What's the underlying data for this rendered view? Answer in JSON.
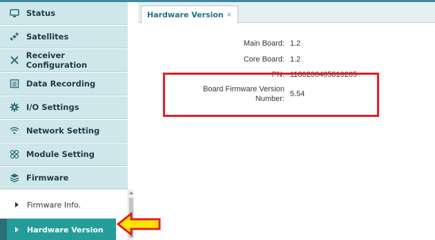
{
  "sidebar": {
    "items": [
      {
        "label": "Status",
        "icon": "status-icon"
      },
      {
        "label": "Satellites",
        "icon": "satellite-icon"
      },
      {
        "label": "Receiver Configuration",
        "icon": "tools-icon"
      },
      {
        "label": "Data Recording",
        "icon": "data-recording-icon"
      },
      {
        "label": "I/O Settings",
        "icon": "gear-icon"
      },
      {
        "label": "Network Setting",
        "icon": "wifi-icon"
      },
      {
        "label": "Module Setting",
        "icon": "module-icon"
      },
      {
        "label": "Firmware",
        "icon": "layers-icon"
      }
    ],
    "submenu": [
      {
        "label": "Firmware Info."
      },
      {
        "label": "Hardware Version"
      }
    ]
  },
  "tab": {
    "label": "Hardware Version",
    "close": "×"
  },
  "hardware": {
    "main_board_label": "Main Board:",
    "main_board_value": "1.2",
    "core_board_label": "Core Board:",
    "core_board_value": "1.2",
    "pn_label": "PN:",
    "pn_value": "1180200405010205",
    "firmware_label_line1": "Board Firmware Version",
    "firmware_label_line2": "Number:",
    "firmware_value": "5.54"
  },
  "colors": {
    "menu_bg": "#cfe7ea",
    "active_bg": "#249c9a",
    "highlight": "#e11b22",
    "arrow_fill": "#ffe600"
  }
}
